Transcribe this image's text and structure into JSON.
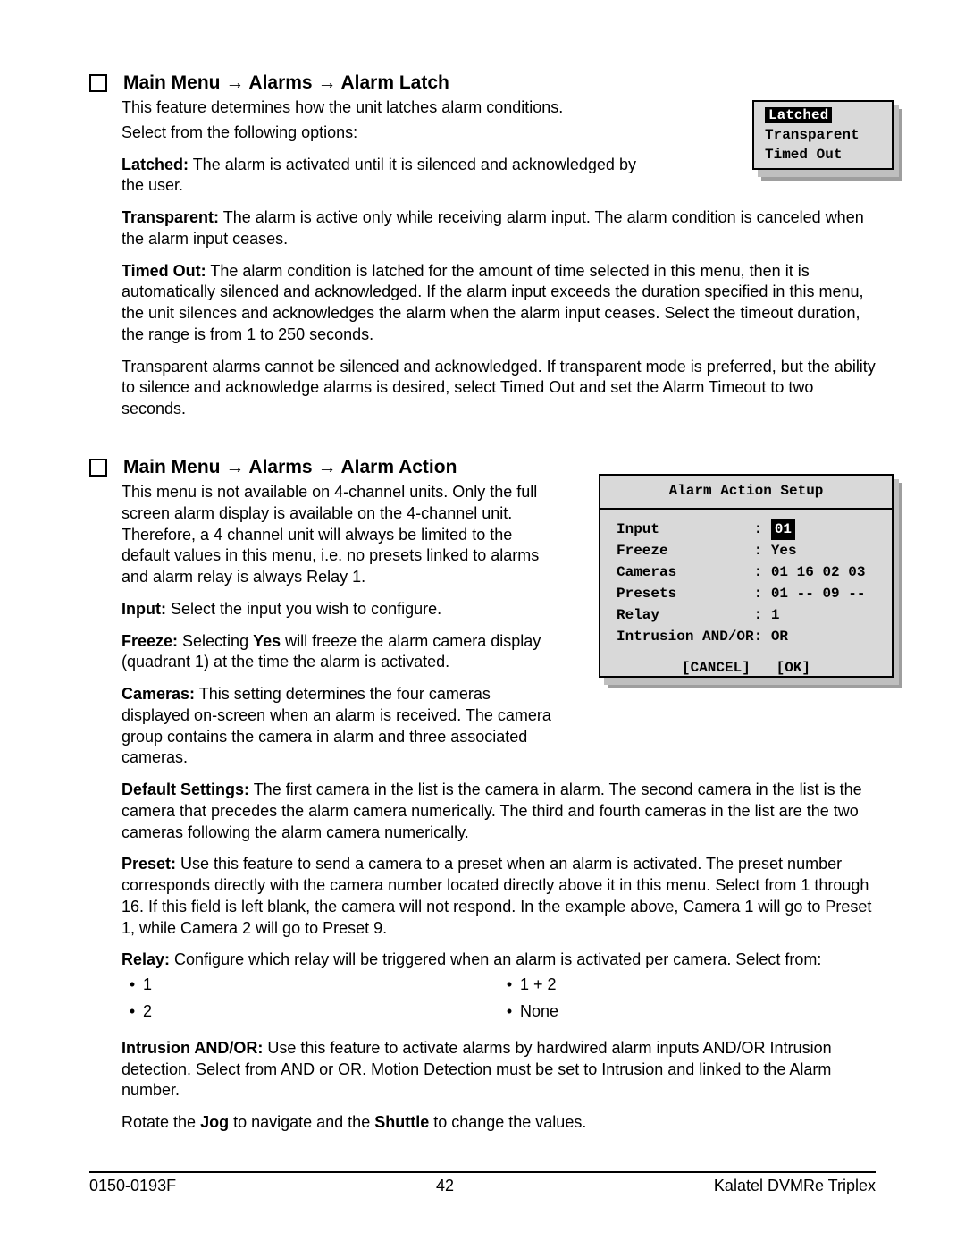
{
  "section1": {
    "heading_prefix": "Main Menu ",
    "heading_mid1": " Alarms ",
    "heading_suffix": " Alarm Latch",
    "arrow": "→",
    "p1": "This feature determines how the unit latches alarm conditions.",
    "p2": "Select from the following options:",
    "latched_label": "Latched:",
    "latched_text": "  The alarm is activated until it is silenced and acknowledged by the user.",
    "transparent_label": "Transparent:",
    "transparent_text": "  The alarm is active only while receiving alarm input.  The alarm condition is canceled when the alarm input ceases.",
    "timedout_label": "Timed Out:",
    "timedout_text": "  The alarm condition is latched for the amount of time selected in this menu, then it is automatically silenced and acknowledged.  If the alarm input exceeds the duration specified in this menu, the unit silences and acknowledges the alarm when the alarm input ceases.  Select the timeout duration, the range is from 1 to 250 seconds.",
    "p_note": "Transparent alarms cannot be silenced and acknowledged.  If transparent mode is preferred, but the ability to silence and acknowledge alarms is desired, select Timed Out and set the Alarm Timeout to two seconds."
  },
  "osd1": {
    "items": [
      "Latched",
      "Transparent",
      "Timed Out"
    ],
    "selected_index": 0
  },
  "section2": {
    "heading_prefix": "Main Menu ",
    "heading_mid1": " Alarms ",
    "heading_suffix": " Alarm Action",
    "arrow": "→",
    "p_intro": "This menu is not available on 4-channel units.  Only the full screen alarm display is available on the 4-channel unit. Therefore, a 4 channel unit will always be limited to the default values in this menu, i.e. no presets linked to alarms and alarm relay is always Relay 1.",
    "input_label": "Input:",
    "input_text": "  Select the input you wish to configure.",
    "freeze_label": "Freeze:",
    "freeze_text_a": "  Selecting ",
    "freeze_yes": "Yes",
    "freeze_text_b": " will freeze the alarm camera display (quadrant 1) at the time the alarm is activated.",
    "cameras_label": "Cameras:",
    "cameras_text": "  This setting determines the four cameras displayed on-screen when an alarm is received.  The camera group contains the camera in alarm and three associated cameras.",
    "default_label": "Default Settings:",
    "default_text": " The first camera in the list is the camera in alarm. The second camera in the list is the camera that precedes the alarm camera numerically.  The third and fourth cameras in the list are the two cameras following the alarm camera numerically.",
    "preset_label": "Preset:",
    "preset_text": "  Use this feature to send a camera to a preset when an alarm is activated.  The preset number corresponds directly with the camera number located directly above it in this menu.  Select from 1 through 16.  If this field is left blank, the camera will not respond.  In the example above, Camera 1 will go to Preset 1, while Camera 2 will go to Preset 9.",
    "relay_label": "Relay:",
    "relay_text": "  Configure which relay will be triggered when an alarm is activated per camera. Select from:",
    "relay_options_left": [
      "1",
      "2"
    ],
    "relay_options_right": [
      "1 + 2",
      "None"
    ],
    "intrusion_label": "Intrusion AND/OR:",
    "intrusion_text": "  Use this feature to activate alarms by hardwired alarm inputs AND/OR Intrusion detection. Select from AND or OR. Motion Detection must be set to Intrusion and linked to the Alarm number.",
    "jog_a": "Rotate the ",
    "jog_bold": "Jog",
    "jog_b": " to navigate and the ",
    "shuttle_bold": "Shuttle",
    "jog_c": " to change the values."
  },
  "osd2": {
    "title": "Alarm Action Setup",
    "rows": [
      {
        "label": "Input",
        "value_prefix": ": ",
        "value_sel": "01",
        "value_suffix": ""
      },
      {
        "label": "Freeze",
        "value": ": Yes"
      },
      {
        "label": "Cameras",
        "value": ": 01 16 02 03"
      },
      {
        "label": "Presets",
        "value": ": 01 -- 09 --"
      },
      {
        "label": "Relay",
        "value": ": 1"
      },
      {
        "label": "Intrusion AND/OR",
        "value": ": OR"
      }
    ],
    "cancel": "[CANCEL]",
    "ok": "[OK]"
  },
  "footer": {
    "left": "0150-0193F",
    "center": "42",
    "right": "Kalatel DVMRe Triplex"
  }
}
